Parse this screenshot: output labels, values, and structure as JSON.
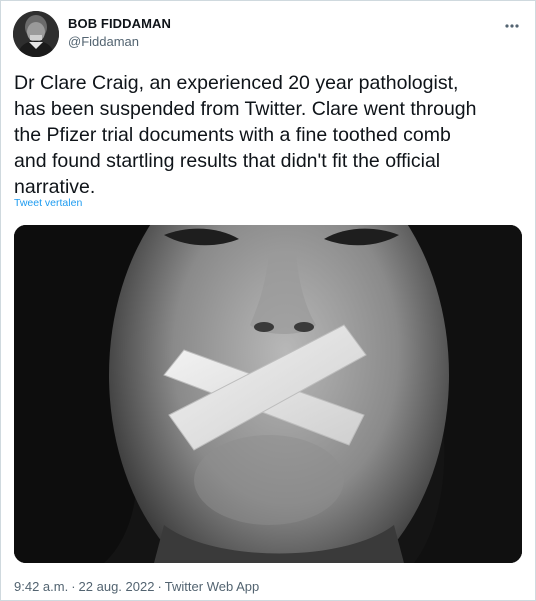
{
  "author": {
    "display_name": "BOB FIDDAMAN",
    "handle": "@Fiddaman"
  },
  "tweet": {
    "text": "Dr Clare Craig, an experienced 20 year pathologist,\nhas been suspended from Twitter. Clare went through\nthe Pfizer trial documents with a fine toothed comb\nand found startling results that didn't fit the official\nnarrative.",
    "translate_link": "Tweet vertalen"
  },
  "meta": {
    "time": "9:42 a.m.",
    "separator": "·",
    "date": "22 aug. 2022",
    "source": "Twitter Web App"
  },
  "icons": {
    "more": "more-horizontal-icon"
  },
  "colors": {
    "text_primary": "#0f1419",
    "text_secondary": "#536471",
    "link": "#1d9bf0",
    "border": "#cfd9de"
  }
}
